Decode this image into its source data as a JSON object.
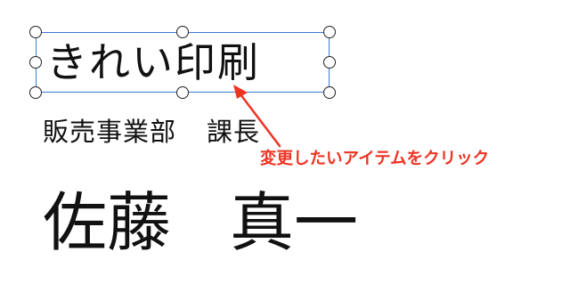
{
  "card": {
    "selected_item_text": "きれい印刷",
    "department": "販売事業部",
    "position": "課長",
    "family_name": "佐藤",
    "given_name": "真一"
  },
  "annotation": {
    "text": "変更したいアイテムをクリック",
    "color": "#ee3322"
  },
  "colors": {
    "selection_frame": "#3a78d8",
    "background": "#ffffff"
  }
}
